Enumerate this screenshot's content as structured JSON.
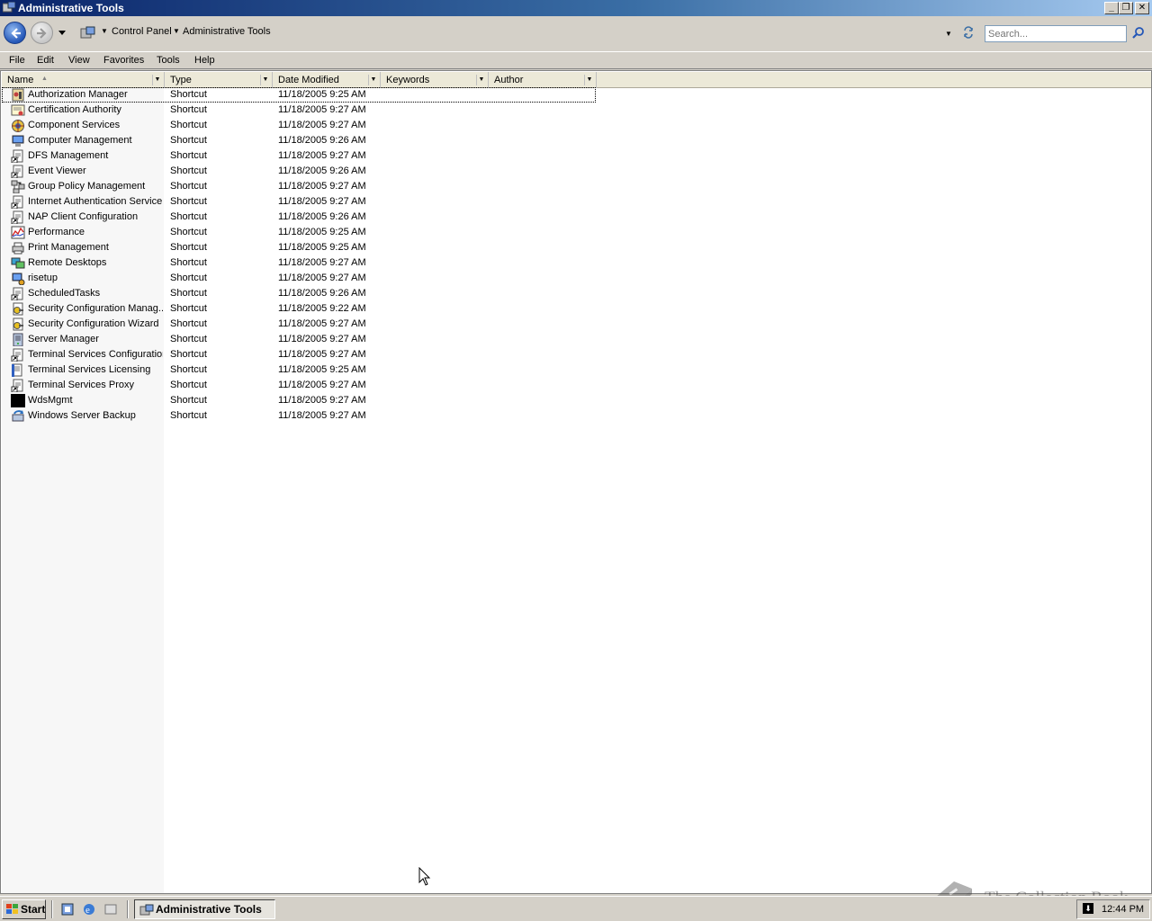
{
  "window": {
    "title": "Administrative Tools"
  },
  "address": {
    "crumbs": [
      "Control Panel",
      "Administrative Tools"
    ],
    "search_placeholder": "Search..."
  },
  "menu": [
    "File",
    "Edit",
    "View",
    "Favorites",
    "Tools",
    "Help"
  ],
  "columns": [
    "Name",
    "Type",
    "Date Modified",
    "Keywords",
    "Author"
  ],
  "rows": [
    {
      "name": "Authorization Manager",
      "type": "Shortcut",
      "date": "11/18/2005 9:25 AM",
      "icon": "authorization-manager-icon"
    },
    {
      "name": "Certification Authority",
      "type": "Shortcut",
      "date": "11/18/2005 9:27 AM",
      "icon": "certification-authority-icon"
    },
    {
      "name": "Component Services",
      "type": "Shortcut",
      "date": "11/18/2005 9:27 AM",
      "icon": "component-services-icon"
    },
    {
      "name": "Computer Management",
      "type": "Shortcut",
      "date": "11/18/2005 9:26 AM",
      "icon": "computer-management-icon"
    },
    {
      "name": "DFS Management",
      "type": "Shortcut",
      "date": "11/18/2005 9:27 AM",
      "icon": "document-shortcut-icon"
    },
    {
      "name": "Event Viewer",
      "type": "Shortcut",
      "date": "11/18/2005 9:26 AM",
      "icon": "document-shortcut-icon"
    },
    {
      "name": "Group Policy Management",
      "type": "Shortcut",
      "date": "11/18/2005 9:27 AM",
      "icon": "group-policy-icon"
    },
    {
      "name": "Internet Authentication Service",
      "type": "Shortcut",
      "date": "11/18/2005 9:27 AM",
      "icon": "document-shortcut-icon"
    },
    {
      "name": "NAP Client Configuration",
      "type": "Shortcut",
      "date": "11/18/2005 9:26 AM",
      "icon": "document-shortcut-icon"
    },
    {
      "name": "Performance",
      "type": "Shortcut",
      "date": "11/18/2005 9:25 AM",
      "icon": "performance-icon"
    },
    {
      "name": "Print Management",
      "type": "Shortcut",
      "date": "11/18/2005 9:25 AM",
      "icon": "print-management-icon"
    },
    {
      "name": "Remote Desktops",
      "type": "Shortcut",
      "date": "11/18/2005 9:27 AM",
      "icon": "remote-desktops-icon"
    },
    {
      "name": "risetup",
      "type": "Shortcut",
      "date": "11/18/2005 9:27 AM",
      "icon": "risetup-icon"
    },
    {
      "name": "ScheduledTasks",
      "type": "Shortcut",
      "date": "11/18/2005 9:26 AM",
      "icon": "document-shortcut-icon"
    },
    {
      "name": "Security Configuration Manag...",
      "type": "Shortcut",
      "date": "11/18/2005 9:22 AM",
      "icon": "security-config-icon"
    },
    {
      "name": "Security Configuration Wizard",
      "type": "Shortcut",
      "date": "11/18/2005 9:27 AM",
      "icon": "security-config-icon"
    },
    {
      "name": "Server Manager",
      "type": "Shortcut",
      "date": "11/18/2005 9:27 AM",
      "icon": "server-manager-icon"
    },
    {
      "name": "Terminal Services Configuration",
      "type": "Shortcut",
      "date": "11/18/2005 9:27 AM",
      "icon": "document-shortcut-icon"
    },
    {
      "name": "Terminal Services Licensing",
      "type": "Shortcut",
      "date": "11/18/2005 9:25 AM",
      "icon": "licensing-icon"
    },
    {
      "name": "Terminal Services Proxy",
      "type": "Shortcut",
      "date": "11/18/2005 9:27 AM",
      "icon": "document-shortcut-icon"
    },
    {
      "name": "WdsMgmt",
      "type": "Shortcut",
      "date": "11/18/2005 9:27 AM",
      "icon": "black-square-icon"
    },
    {
      "name": "Windows Server Backup",
      "type": "Shortcut",
      "date": "11/18/2005 9:27 AM",
      "icon": "server-backup-icon"
    }
  ],
  "taskbar": {
    "start_label": "Start",
    "task_label": "Administrative Tools",
    "clock": "12:44 PM"
  },
  "watermark": "The Collection Book"
}
